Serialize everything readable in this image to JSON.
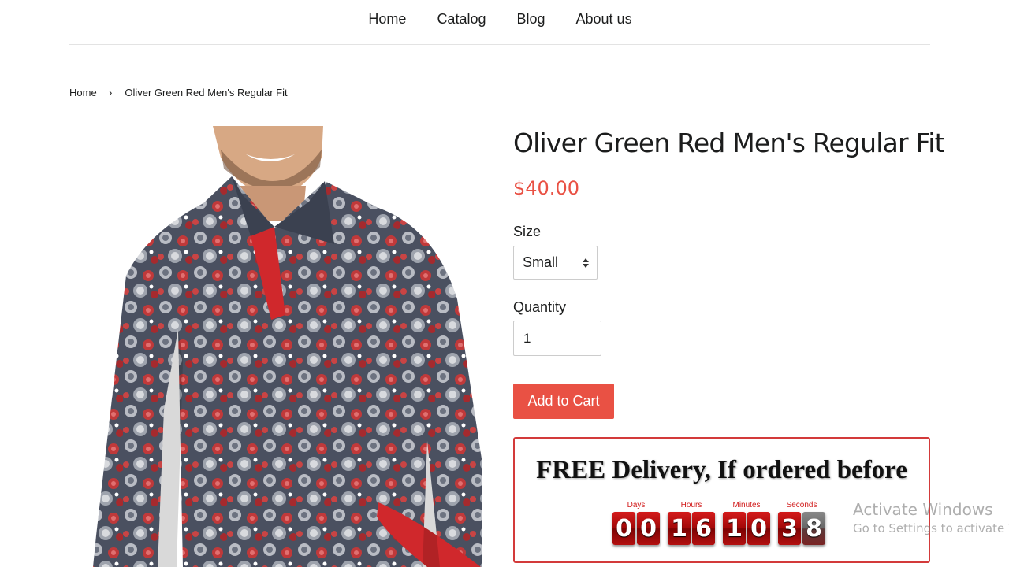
{
  "nav": {
    "items": [
      {
        "label": "Home"
      },
      {
        "label": "Catalog"
      },
      {
        "label": "Blog"
      },
      {
        "label": "About us"
      }
    ]
  },
  "breadcrumb": {
    "home": "Home",
    "separator": "›",
    "current": "Oliver Green Red Men's Regular Fit"
  },
  "product": {
    "title": "Oliver Green Red Men's Regular Fit",
    "price": "$40.00",
    "size_label": "Size",
    "size_value": "Small",
    "quantity_label": "Quantity",
    "quantity_value": "1",
    "add_to_cart": "Add to Cart",
    "image_icon": "product-photo-patterned-shirt"
  },
  "delivery": {
    "title": "FREE Delivery, If ordered before",
    "labels": {
      "days": "Days",
      "hours": "Hours",
      "minutes": "Minutes",
      "seconds": "Seconds"
    },
    "digits": {
      "days": [
        "0",
        "0"
      ],
      "hours": [
        "1",
        "6"
      ],
      "minutes": [
        "1",
        "0"
      ],
      "seconds": [
        "3",
        "8"
      ]
    }
  },
  "watermark": {
    "line1": "Activate Windows",
    "line2": "Go to Settings to activate W"
  },
  "colors": {
    "accent": "#e95144",
    "border_red": "#d33a3a",
    "digit_red": "#b31010"
  }
}
